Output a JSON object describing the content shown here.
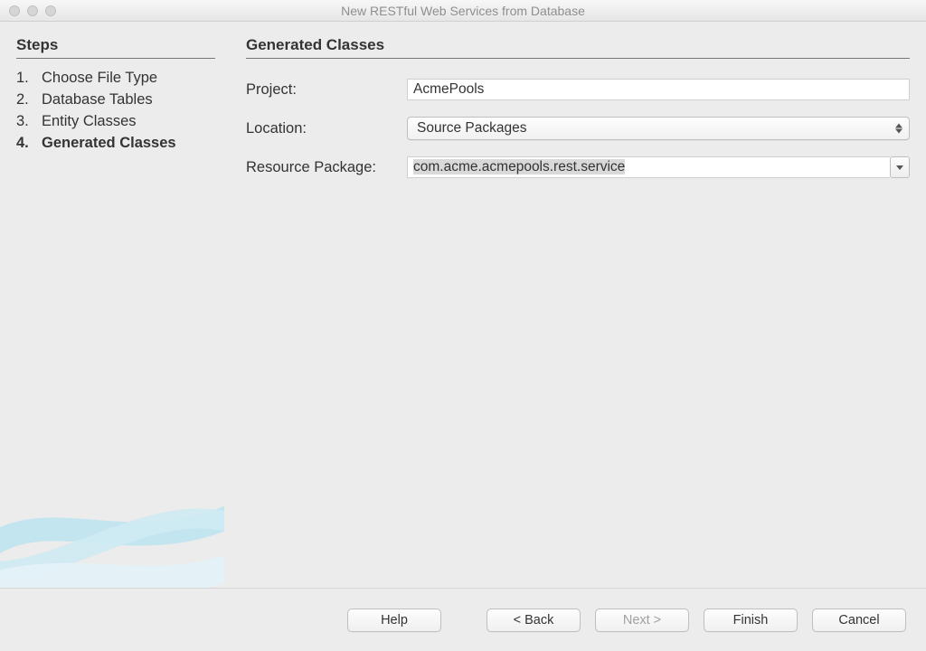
{
  "window": {
    "title": "New RESTful Web Services from Database"
  },
  "sidebar": {
    "heading": "Steps",
    "steps": [
      {
        "num": "1.",
        "label": "Choose File Type"
      },
      {
        "num": "2.",
        "label": "Database Tables"
      },
      {
        "num": "3.",
        "label": "Entity Classes"
      },
      {
        "num": "4.",
        "label": "Generated Classes"
      }
    ],
    "current_index": 3
  },
  "main": {
    "heading": "Generated Classes",
    "project": {
      "label": "Project:",
      "value": "AcmePools"
    },
    "location": {
      "label": "Location:",
      "value": "Source Packages"
    },
    "resource_package": {
      "label": "Resource Package:",
      "value": "com.acme.acmepools.rest.service"
    }
  },
  "footer": {
    "help": "Help",
    "back": "< Back",
    "next": "Next >",
    "finish": "Finish",
    "cancel": "Cancel"
  }
}
